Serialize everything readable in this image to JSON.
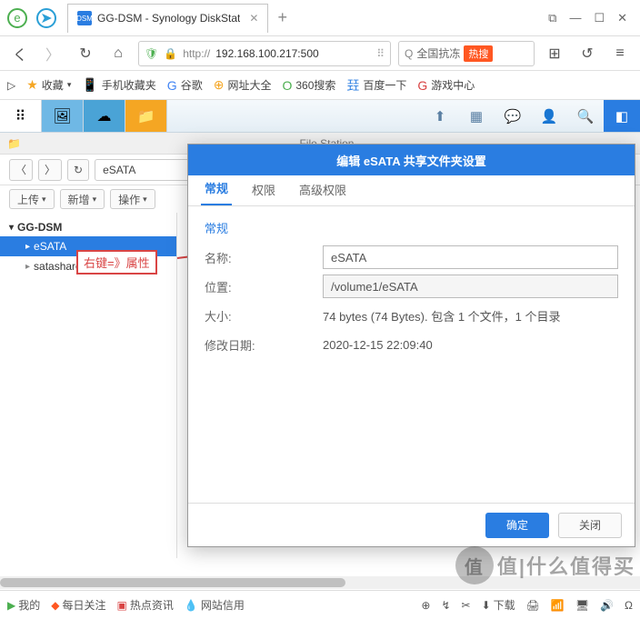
{
  "browser": {
    "tab_title": "GG-DSM - Synology DiskStat",
    "url": "192.168.100.217:500",
    "url_prefix": "http://",
    "search_placeholder": "全国抗冻",
    "hot_label": "热搜"
  },
  "bookmarks": {
    "fav": "收藏",
    "mobile": "手机收藏夹",
    "google": "谷歌",
    "sites": "网址大全",
    "so360": "360搜索",
    "baidu": "百度一下",
    "games": "游戏中心"
  },
  "filestation": {
    "window_title": "File Station",
    "path": "eSATA",
    "upload": "上传",
    "create": "新增",
    "operate": "操作",
    "tree_root": "GG-DSM",
    "tree_esata": "eSATA",
    "tree_share": "satashare1-1"
  },
  "annotation": "右键=》属性",
  "dialog": {
    "title": "编辑 eSATA 共享文件夹设置",
    "tabs": {
      "general": "常规",
      "perm": "权限",
      "advperm": "高级权限"
    },
    "section": "常规",
    "name_label": "名称:",
    "name_value": "eSATA",
    "location_label": "位置:",
    "location_value": "/volume1/eSATA",
    "size_label": "大小:",
    "size_value": "74 bytes (74 Bytes). 包含 1 个文件，1 个目录",
    "modified_label": "修改日期:",
    "modified_value": "2020-12-15 22:09:40",
    "ok": "确定",
    "close": "关闭"
  },
  "statusbar": {
    "my": "我的",
    "daily": "每日关注",
    "news": "热点资讯",
    "credit": "网站信用",
    "download": "下载"
  },
  "watermark": "值|什么值得买"
}
